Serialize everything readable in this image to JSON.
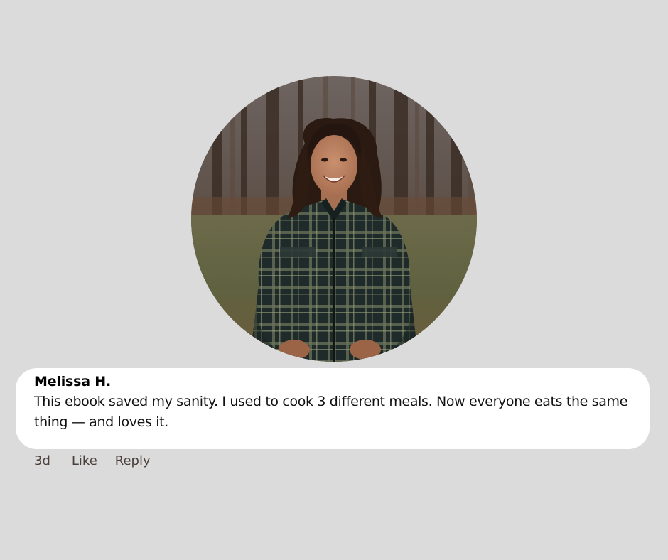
{
  "comment": {
    "author": "Melissa H.",
    "text": "This ebook saved my sanity. I used to cook 3 different meals. Now everyone eats the same thing — and loves it.",
    "avatar_alt": "Melissa H. profile photo",
    "actions": {
      "time": "3d",
      "like": "Like",
      "reply": "Reply"
    }
  },
  "colors": {
    "page_background": "#dbdbdb",
    "bubble_background": "#ffffff",
    "action_text": "#4a3f3a"
  }
}
